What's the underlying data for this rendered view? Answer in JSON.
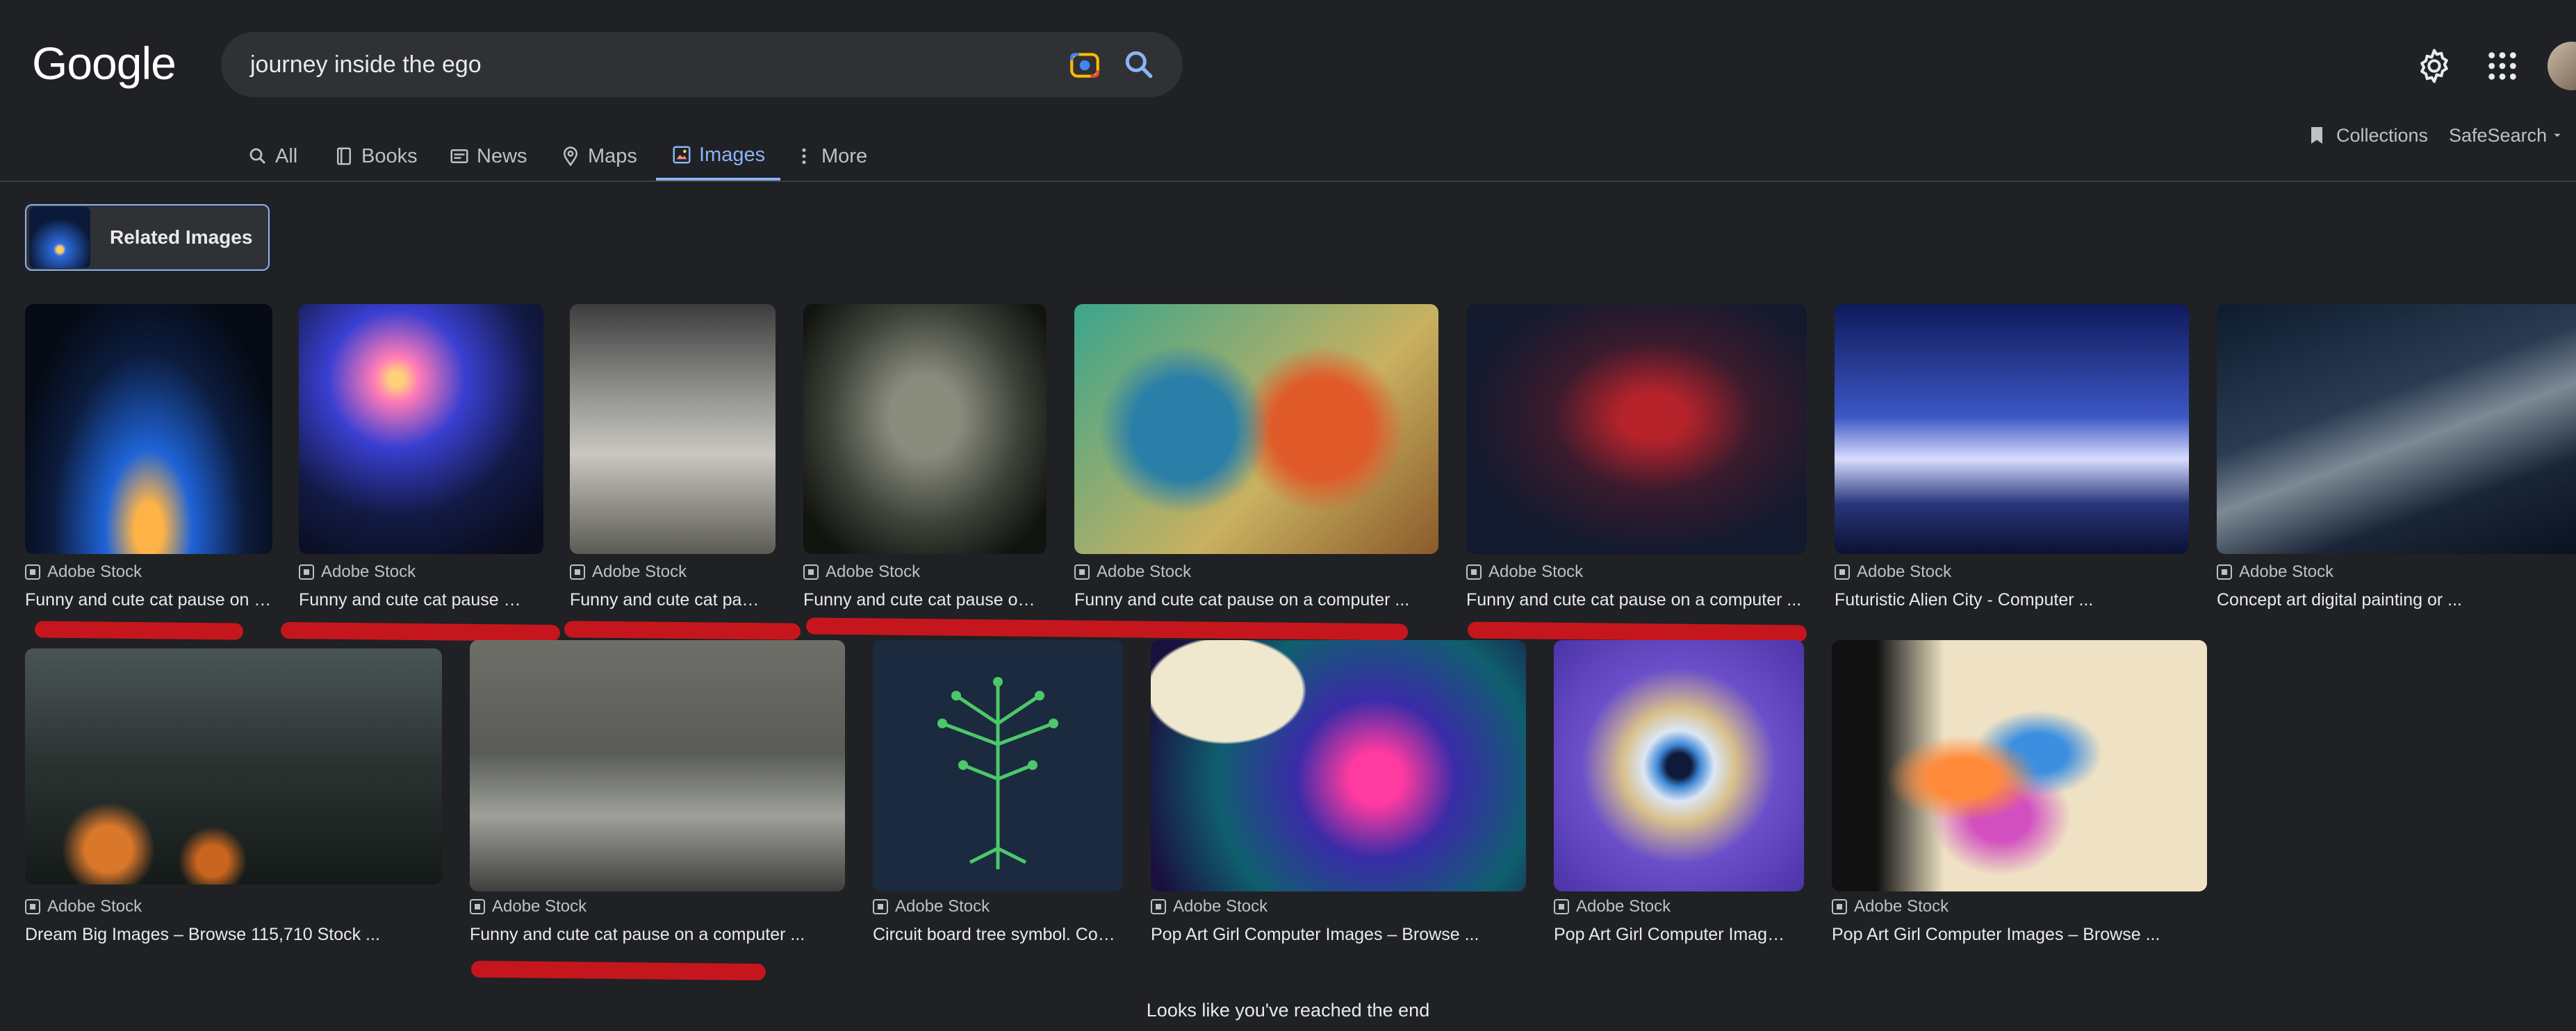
{
  "header": {
    "logo": "Google",
    "search_query": "journey inside the ego"
  },
  "tabs": [
    {
      "label": "All"
    },
    {
      "label": "Books"
    },
    {
      "label": "News"
    },
    {
      "label": "Maps"
    },
    {
      "label": "Images"
    },
    {
      "label": "More"
    }
  ],
  "right_nav": {
    "collections": "Collections",
    "safesearch": "SafeSearch"
  },
  "related": {
    "label": "Related Images"
  },
  "results": [
    {
      "source": "Adobe Stock",
      "caption": "Funny and cute cat pause on a computer ..."
    },
    {
      "source": "Adobe Stock",
      "caption": "Funny and cute cat pause on a computer ..."
    },
    {
      "source": "Adobe Stock",
      "caption": "Funny and cute cat pause on a computer ..."
    },
    {
      "source": "Adobe Stock",
      "caption": "Funny and cute cat pause on a computer ..."
    },
    {
      "source": "Adobe Stock",
      "caption": "Funny and cute cat pause on a computer ..."
    },
    {
      "source": "Adobe Stock",
      "caption": "Funny and cute cat pause on a computer ..."
    },
    {
      "source": "Adobe Stock",
      "caption": "Futuristic Alien City - Computer ..."
    },
    {
      "source": "Adobe Stock",
      "caption": "Concept art digital painting or ..."
    },
    {
      "source": "Adobe Stock",
      "caption": "Dream Big Images – Browse 115,710 Stock ..."
    },
    {
      "source": "Adobe Stock",
      "caption": "Funny and cute cat pause on a computer ..."
    },
    {
      "source": "Adobe Stock",
      "caption": "Circuit board tree symbol. Computer ..."
    },
    {
      "source": "Adobe Stock",
      "caption": "Pop Art Girl Computer Images – Browse ..."
    },
    {
      "source": "Adobe Stock",
      "caption": "Pop Art Girl Computer Images – Browse ..."
    },
    {
      "source": "Adobe Stock",
      "caption": "Pop Art Girl Computer Images – Browse ..."
    }
  ],
  "footer": {
    "end_message": "Looks like you've reached the end"
  },
  "colors": {
    "background": "#202124",
    "accent": "#8ab4f8",
    "annotation_red": "#c5161d"
  },
  "icons": [
    "camera-icon",
    "search-icon",
    "settings-gear-icon",
    "apps-grid-icon",
    "bookmark-icon",
    "chevron-down-icon"
  ]
}
